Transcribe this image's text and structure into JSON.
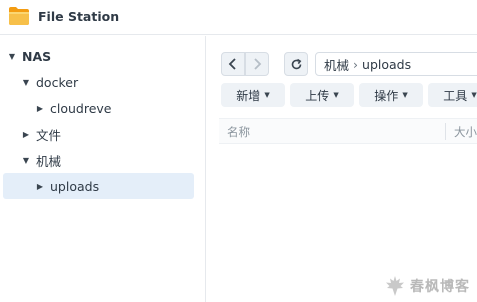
{
  "app": {
    "title": "File Station",
    "icon": "folder-icon",
    "accent": "#f5b53f"
  },
  "sidebar": {
    "root": "NAS",
    "items": [
      {
        "label": "docker",
        "expanded": true
      },
      {
        "label": "cloudreve",
        "expanded": false
      },
      {
        "label": "文件",
        "expanded": false
      },
      {
        "label": "机械",
        "expanded": true
      },
      {
        "label": "uploads",
        "expanded": false,
        "selected": true
      }
    ],
    "selected_bg": "#e4eef9"
  },
  "toolbar": {
    "path": [
      "机械",
      "uploads"
    ],
    "buttons": {
      "new": "新增",
      "upload": "上传",
      "action": "操作",
      "tools": "工具"
    }
  },
  "table": {
    "columns": [
      "名称",
      "大小"
    ]
  },
  "watermark": {
    "text": "春枫博客"
  }
}
